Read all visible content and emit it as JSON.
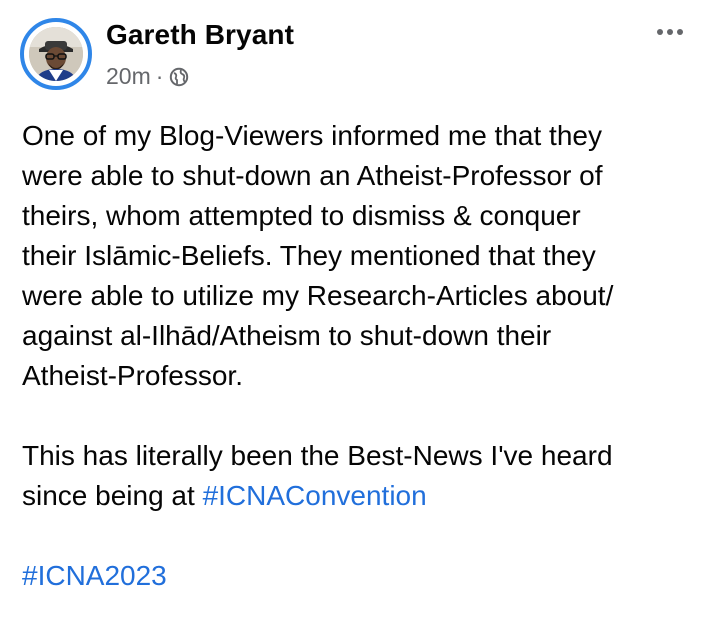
{
  "post": {
    "author": {
      "name": "Gareth Bryant",
      "avatar_icon": "profile-photo"
    },
    "timestamp": "20m",
    "separator": "·",
    "audience_icon": "globe-icon",
    "more_icon": "more-options-icon",
    "paragraph1": "One of my Blog-Viewers informed me that they\nwere able to shut-down an Atheist-Professor of\ntheirs, whom attempted to dismiss & conquer\ntheir Islāmic-Beliefs. They mentioned that they\nwere able to utilize my Research-Articles about/\nagainst al-Ilhād/Atheism to shut-down their\nAtheist-Professor.",
    "paragraph2_line1": "This has literally been the Best-News I've heard",
    "paragraph2_line2_prefix": "since being at ",
    "hashtag1": "#ICNAConvention",
    "hashtag2": "#ICNA2023"
  },
  "colors": {
    "link": "#216fdb",
    "ring": "#2f86e8",
    "secondary_text": "#65676b",
    "primary_text": "#050505"
  }
}
